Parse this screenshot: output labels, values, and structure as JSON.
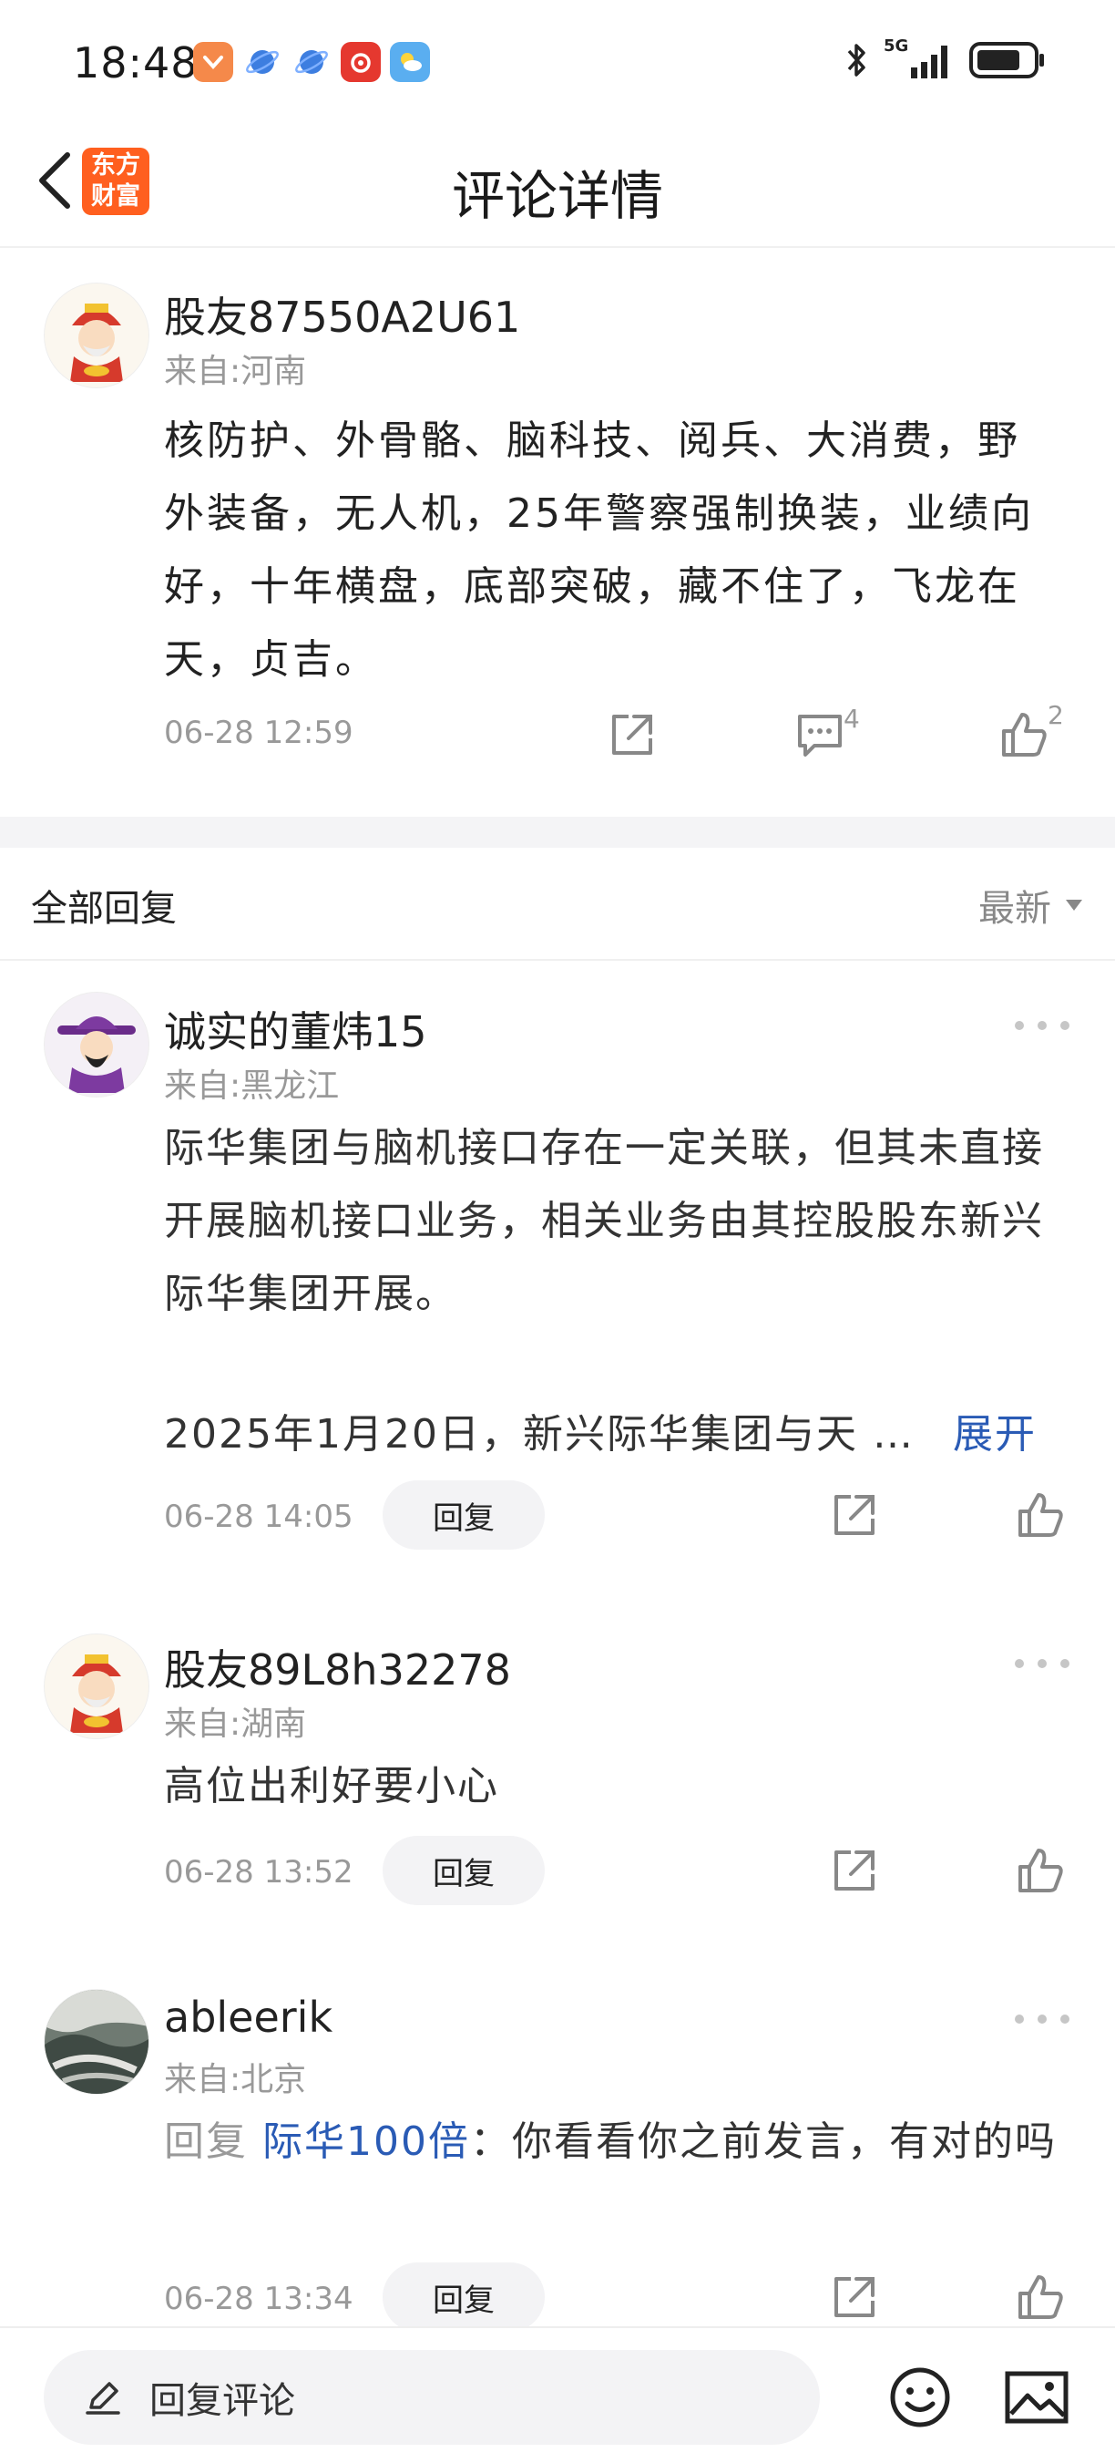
{
  "status_bar": {
    "time": "18:48",
    "network": "5G",
    "app_icons": [
      "taobao-icon",
      "browser-icon",
      "browser-icon",
      "netease-music-icon",
      "weather-icon"
    ]
  },
  "header": {
    "title": "评论详情",
    "logo_line1": "东方",
    "logo_line2": "财富"
  },
  "post": {
    "username": "股友87550A2U61",
    "location": "来自:河南",
    "content": "核防护、外骨骼、脑科技、阅兵、大消费，野外装备，无人机，25年警察强制换装，业绩向好，十年横盘，底部突破，藏不住了，飞龙在天，贞吉。",
    "time": "06-28 12:59",
    "comment_count": "4",
    "like_count": "2"
  },
  "replies_header": {
    "title": "全部回复",
    "sort": "最新"
  },
  "replies": [
    {
      "username": "诚实的董炜15",
      "location": "来自:黑龙江",
      "content": "际华集团与脑机接口存在一定关联，但其未直接开展脑机接口业务，相关业务由其控股股东新兴际华集团开展。",
      "content_more": "2025年1月20日，新兴际华集团与天 …",
      "expand": "展开",
      "time": "06-28 14:05",
      "reply_label": "回复"
    },
    {
      "username": "股友89L8h32278",
      "location": "来自:湖南",
      "content": "高位出利好要小心",
      "time": "06-28 13:52",
      "reply_label": "回复"
    },
    {
      "username": "ableerik",
      "location": "来自:北京",
      "prefix": "回复 ",
      "mention": "际华100倍",
      "content": "：你看看你之前发言，有对的吗",
      "time": "06-28 13:34",
      "reply_label": "回复"
    }
  ],
  "bottom_bar": {
    "placeholder": "回复评论"
  },
  "colors": {
    "brand": "#ff5f1f",
    "link": "#2a5bb5",
    "muted": "#999999"
  }
}
